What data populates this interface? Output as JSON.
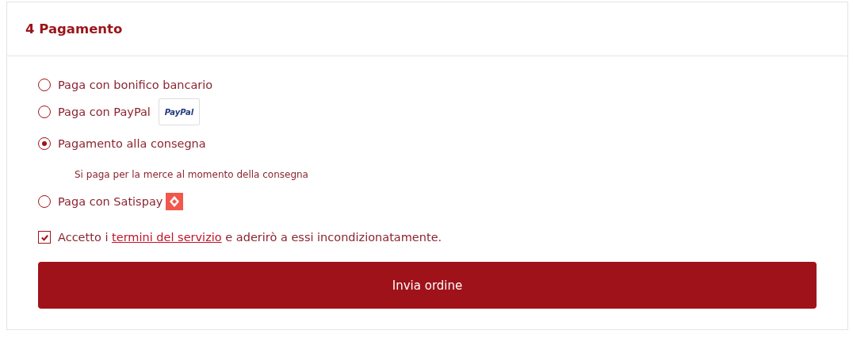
{
  "section": {
    "title": "4 Pagamento"
  },
  "payment_options": [
    {
      "label": "Paga con bonifico bancario",
      "kind": "plain",
      "selected": false
    },
    {
      "label": "Paga con PayPal",
      "kind": "paypal",
      "logo_text": "PayPal",
      "selected": false
    },
    {
      "label": "Pagamento alla consegna",
      "kind": "plain",
      "selected": true,
      "description": "Si paga per la merce al momento della consegna"
    },
    {
      "label": "Paga con Satispay",
      "kind": "satispay",
      "selected": false
    }
  ],
  "terms": {
    "checked": true,
    "before": "Accetto i",
    "link": "termini del servizio",
    "after": "e aderirò a essi incondizionatamente."
  },
  "submit_button": "Invia ordine"
}
